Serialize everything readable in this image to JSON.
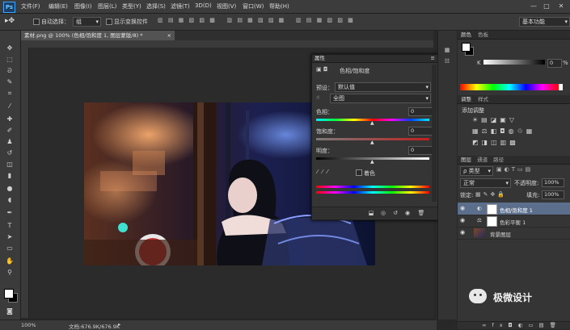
{
  "app": {
    "logo": "Ps"
  },
  "menu": [
    "文件(F)",
    "编辑(E)",
    "图像(I)",
    "图层(L)",
    "类型(Y)",
    "选择(S)",
    "滤镜(T)",
    "3D(D)",
    "视图(V)",
    "窗口(W)",
    "帮助(H)"
  ],
  "window_controls": [
    "—",
    "□",
    "✕"
  ],
  "options_bar": {
    "auto_select_label": "自动选择：",
    "auto_select_value": "组",
    "show_transform_label": "显示变换控件",
    "workspace": "基本功能"
  },
  "document": {
    "tab_title": "素材.png @ 100% (色相/饱和度 1, 图层蒙版/8) *"
  },
  "status": {
    "zoom": "100%",
    "doc_info": "文档:676.9K/676.9K"
  },
  "properties": {
    "panel_tab": "属性",
    "title": "色相/饱和度",
    "preset_label": "预设：",
    "preset_value": "默认值",
    "channel_value": "全图",
    "hue_label": "色相：",
    "hue_value": "0",
    "saturation_label": "饱和度：",
    "saturation_value": "0",
    "lightness_label": "明度：",
    "lightness_value": "0",
    "colorize_label": "着色"
  },
  "color_panel": {
    "tabs": [
      "颜色",
      "色板"
    ],
    "k_label": "K",
    "k_value": "0",
    "k_unit": "%"
  },
  "adjustments_panel": {
    "tabs": [
      "调整",
      "样式"
    ],
    "title": "添加调整"
  },
  "layers_panel": {
    "tabs": [
      "图层",
      "通道",
      "路径"
    ],
    "kind_label": "ρ 类型",
    "blend_mode": "正常",
    "opacity_label": "不透明度:",
    "opacity_value": "100%",
    "lock_label": "锁定:",
    "fill_label": "填充:",
    "fill_value": "100%",
    "layers": [
      {
        "name": "色相/饱和度 1"
      },
      {
        "name": "色彩平衡 1"
      },
      {
        "name": "背景图层"
      }
    ]
  },
  "watermark": {
    "text": "极微设计"
  },
  "colors": {
    "accent_selected_layer": "#5b6f8c",
    "ps_blue": "#3ea6ff"
  }
}
